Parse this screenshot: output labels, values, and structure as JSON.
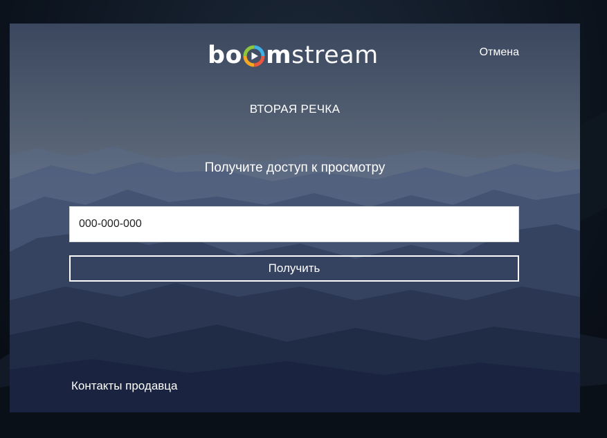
{
  "logo": {
    "part1": "bo",
    "part2": "m",
    "part3": "stream",
    "mark_icon": "play-circle-icon",
    "mark_colors": [
      "#3db0e6",
      "#e9573f",
      "#8cc63f",
      "#f5a623"
    ]
  },
  "header": {
    "cancel_label": "Отмена"
  },
  "channel": {
    "title": "ВТОРАЯ РЕЧКА"
  },
  "access": {
    "heading": "Получите доступ к просмотру",
    "input_placeholder": "000-000-000",
    "submit_label": "Получить"
  },
  "footer": {
    "seller_contacts_label": "Контакты продавца"
  },
  "colors": {
    "modal_overlay": "#3c4a62",
    "text": "#ffffff",
    "input_bg": "#ffffff"
  }
}
